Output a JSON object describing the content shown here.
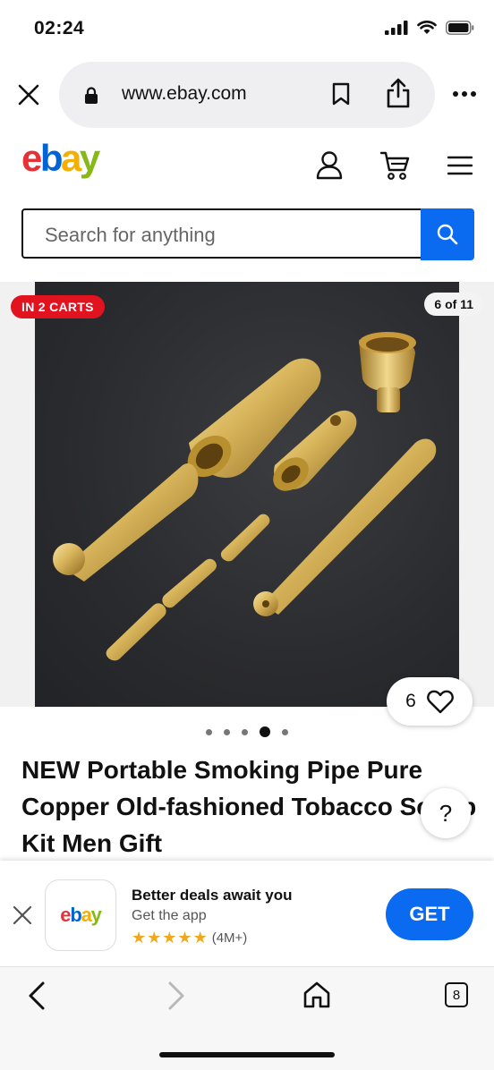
{
  "status_bar": {
    "time": "02:24"
  },
  "browser": {
    "url": "www.ebay.com",
    "tab_count": "8"
  },
  "header": {
    "logo": [
      {
        "char": "e",
        "color": "#e53238"
      },
      {
        "char": "b",
        "color": "#0064d2"
      },
      {
        "char": "a",
        "color": "#f5af02"
      },
      {
        "char": "y",
        "color": "#86b817"
      }
    ]
  },
  "search": {
    "placeholder": "Search for anything"
  },
  "listing": {
    "carts_badge": "IN 2 CARTS",
    "image_counter": "6 of 11",
    "watch_count": "6",
    "title": "NEW Portable Smoking Pipe Pure Copper Old-fashioned Tobacco Scoop Kit Men Gift",
    "help_label": "?",
    "active_image_dot": 4
  },
  "app_banner": {
    "title": "Better deals await you",
    "subtitle": "Get the app",
    "rating_count": "(4M+)",
    "rating_stars": 5,
    "get_label": "GET",
    "app_icon_text": "ebay"
  },
  "colors": {
    "accent": "#0a6bf0",
    "badge": "#e0131e",
    "star": "#f0a81e"
  }
}
